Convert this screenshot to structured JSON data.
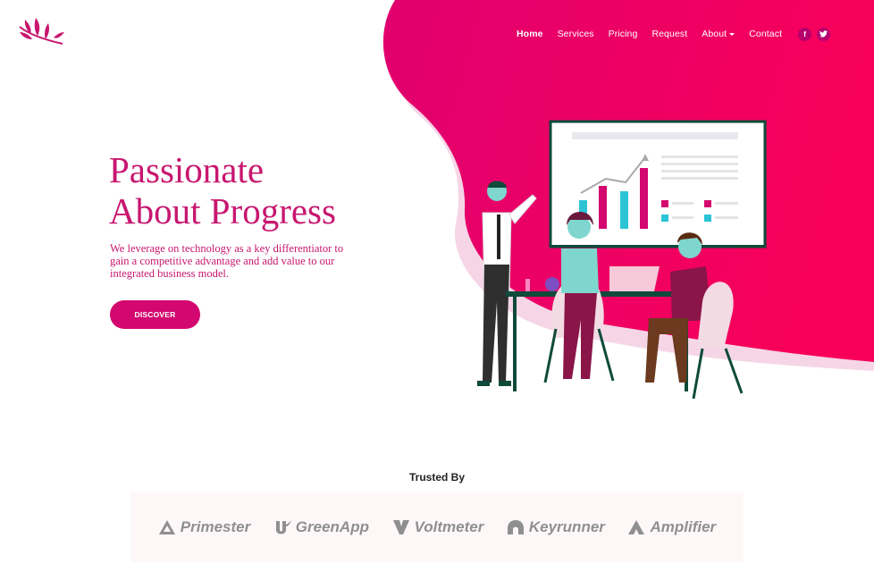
{
  "nav": {
    "items": [
      {
        "label": "Home"
      },
      {
        "label": "Services"
      },
      {
        "label": "Pricing"
      },
      {
        "label": "Request"
      },
      {
        "label": "About"
      },
      {
        "label": "Contact"
      }
    ],
    "social": {
      "facebook": "f",
      "twitter": "t"
    }
  },
  "hero": {
    "title_line1": "Passionate",
    "title_line2": "About Progress",
    "text": "We leverage on technology as a key differentiator to gain a competitive advantage and add value to our integrated business model.",
    "cta": "DISCOVER"
  },
  "trusted": {
    "heading": "Trusted By",
    "brands": [
      {
        "name": "Primester",
        "icon": "triangle-logo-icon"
      },
      {
        "name": "GreenApp",
        "icon": "leaf-logo-icon"
      },
      {
        "name": "Voltmeter",
        "icon": "v-logo-icon"
      },
      {
        "name": "Keyrunner",
        "icon": "k-logo-icon"
      },
      {
        "name": "Amplifier",
        "icon": "a-logo-icon"
      }
    ]
  },
  "colors": {
    "accent": "#d3076f",
    "accent_dark": "#b5006e",
    "blob_start": "#e0006f",
    "blob_end": "#f5005a"
  }
}
